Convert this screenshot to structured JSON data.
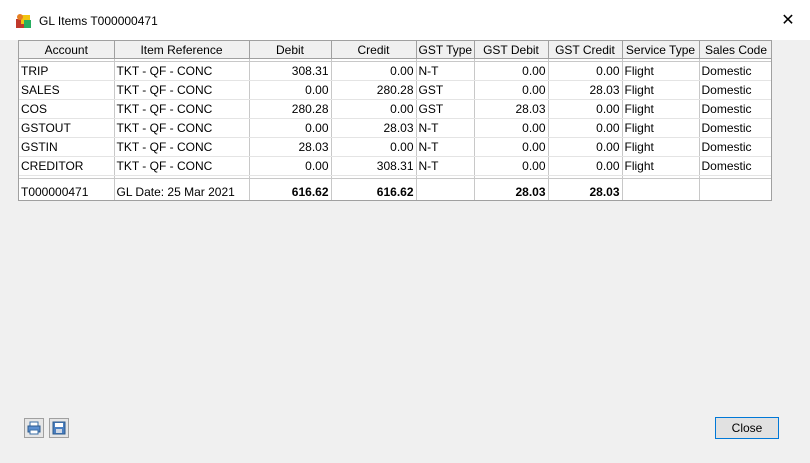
{
  "window": {
    "title": "GL Items T000000471",
    "close_glyph": "✕"
  },
  "table": {
    "columns": [
      "Account",
      "Item Reference",
      "Debit",
      "Credit",
      "GST  Type",
      "GST  Debit",
      "GST  Credit",
      "Service Type",
      "Sales Code"
    ],
    "rows": [
      [
        "TRIP",
        "TKT - QF - CONC",
        "308.31",
        "0.00",
        "N-T",
        "0.00",
        "0.00",
        "Flight",
        "Domestic"
      ],
      [
        "SALES",
        "TKT - QF - CONC",
        "0.00",
        "280.28",
        "GST",
        "0.00",
        "28.03",
        "Flight",
        "Domestic"
      ],
      [
        "COS",
        "TKT - QF - CONC",
        "280.28",
        "0.00",
        "GST",
        "28.03",
        "0.00",
        "Flight",
        "Domestic"
      ],
      [
        "GSTOUT",
        "TKT - QF - CONC",
        "0.00",
        "28.03",
        "N-T",
        "0.00",
        "0.00",
        "Flight",
        "Domestic"
      ],
      [
        "GSTIN",
        "TKT - QF - CONC",
        "28.03",
        "0.00",
        "N-T",
        "0.00",
        "0.00",
        "Flight",
        "Domestic"
      ],
      [
        "CREDITOR",
        "TKT - QF - CONC",
        "0.00",
        "308.31",
        "N-T",
        "0.00",
        "0.00",
        "Flight",
        "Domestic"
      ]
    ],
    "total": [
      "T000000471",
      "GL Date: 25 Mar 2021",
      "616.62",
      "616.62",
      "",
      "28.03",
      "28.03",
      "",
      ""
    ]
  },
  "buttons": {
    "close_label": "Close"
  },
  "icons": [
    "app-icon",
    "print-icon",
    "save-icon"
  ]
}
